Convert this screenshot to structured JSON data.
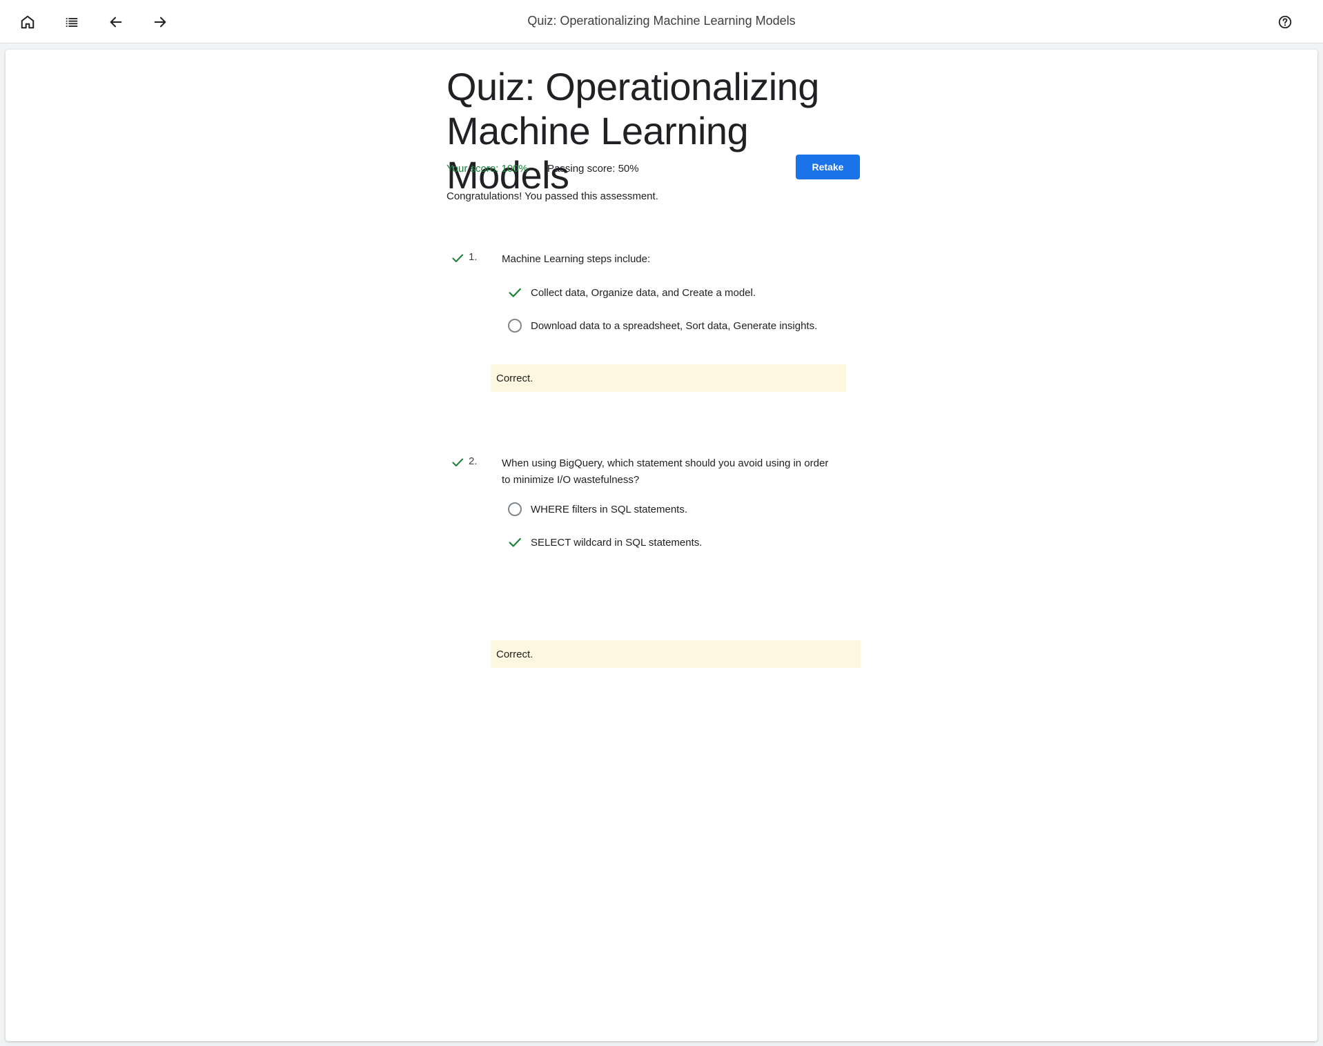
{
  "toolbar": {
    "title": "Quiz: Operationalizing Machine Learning Models",
    "icons": [
      "home-icon",
      "list-icon",
      "arrow-back-icon",
      "arrow-forward-icon",
      "help-icon"
    ]
  },
  "quiz": {
    "title": "Quiz: Operationalizing Machine Learning Models",
    "your_score": "Your score: 100%",
    "passing_score": "Passing score: 50%",
    "retake_label": "Retake",
    "message": "Congratulations! You passed this assessment."
  },
  "questions": [
    {
      "number": "1.",
      "text": "Machine Learning steps include:",
      "correct": true,
      "options": [
        {
          "label": "Collect data, Organize data, and Create a model.",
          "selected": true
        },
        {
          "label": "Download data to a spreadsheet, Sort data, Generate insights.",
          "selected": false
        }
      ],
      "feedback": "Correct."
    },
    {
      "number": "2.",
      "text": "When using BigQuery, which statement should you avoid using in order to minimize I/O wastefulness?",
      "correct": true,
      "options": [
        {
          "label": "WHERE filters in SQL statements.",
          "selected": false
        },
        {
          "label": "SELECT wildcard in SQL statements.",
          "selected": true
        }
      ],
      "feedback": "Correct."
    }
  ],
  "colors": {
    "accent": "#1a73e8",
    "success": "#188038",
    "feedback_bg": "#fef7e0"
  }
}
